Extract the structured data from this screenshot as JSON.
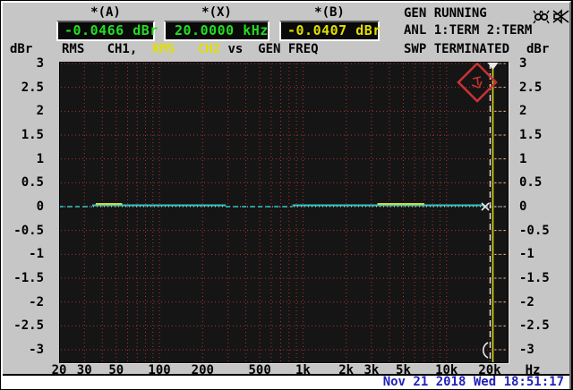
{
  "header": {
    "readouts": [
      {
        "label": "*(A)",
        "value": "-0.0466 dBr",
        "color": "#22dd22"
      },
      {
        "label": "*(X)",
        "value": "20.0000 kHz",
        "color": "#22dd22"
      },
      {
        "label": "*(B)",
        "value": "-0.0407 dBr",
        "color": "#e2de00"
      }
    ],
    "status_lines": [
      "GEN RUNNING",
      "ANL 1:TERM 2:TERM",
      "SWP TERMINATED"
    ],
    "icons": [
      "sweep-bug-icon",
      "mute-speaker-icon"
    ]
  },
  "trace_row": {
    "left_unit": "dBr",
    "ch1": "RMS   CH1,  ",
    "ch2": "RMS   CH2",
    "rest": " vs  GEN FREQ",
    "right_unit": "dBr"
  },
  "chart_data": {
    "type": "line",
    "title": "RMS CH1, RMS CH2 vs GEN FREQ",
    "x_axis": {
      "label": "Hz",
      "scale": "log",
      "min_hz": 20,
      "max_hz": 28000,
      "tick_hz": [
        20,
        30,
        50,
        100,
        200,
        500,
        1000,
        2000,
        3000,
        5000,
        10000,
        20000
      ],
      "tick_labels": [
        "20",
        "30",
        "50",
        "100",
        "200",
        "500",
        "1k",
        "2k",
        "3k",
        "5k",
        "10k",
        "20k"
      ],
      "minor_hz": [
        30,
        40,
        50,
        60,
        70,
        80,
        90,
        100,
        200,
        300,
        400,
        500,
        600,
        700,
        800,
        900,
        1000,
        2000,
        3000,
        4000,
        5000,
        6000,
        7000,
        8000,
        9000,
        10000,
        20000
      ]
    },
    "y_axis": {
      "label": "dBr",
      "min": -3,
      "max": 3,
      "step": 0.5,
      "ticks": [
        3,
        2.5,
        2,
        1.5,
        1,
        0.5,
        0,
        -0.5,
        -1,
        -1.5,
        -2,
        -2.5,
        -3
      ],
      "tick_labels": [
        "3",
        "2.5",
        "2",
        "1.5",
        "1",
        "0.5",
        "0",
        "-0.5",
        "-1",
        "-1.5",
        "-2",
        "-2.5",
        "-3"
      ]
    },
    "grid": {
      "color": "#b03232",
      "style": "dotted",
      "zero_line_color": "#d8d8d8"
    },
    "series": [
      {
        "name": "RMS CH1",
        "color": "#35c8c8",
        "description": "flat response ~ -0.05 dBr from 20 Hz to 20 kHz",
        "solid_hz": [
          [
            34,
            290
          ],
          [
            845,
            18500
          ]
        ],
        "on_zero_dashed_hz": [
          [
            20,
            34
          ],
          [
            290,
            845
          ]
        ]
      },
      {
        "name": "RMS CH2",
        "color": "#d8d828",
        "description": "flat response ~ -0.04 dBr, visible above CH1 near 30-60 Hz and 3-7 kHz",
        "visible_hz": [
          [
            36,
            55
          ],
          [
            3300,
            7000
          ]
        ]
      }
    ],
    "cursor": {
      "x_hz": 20000,
      "a_value_dbr": -0.0466,
      "b_value_dbr": -0.0407
    },
    "marker": "red-diamond-sweep-marker"
  },
  "footer": {
    "datetime": "Nov 21 2018 Wed 18:51:17"
  }
}
